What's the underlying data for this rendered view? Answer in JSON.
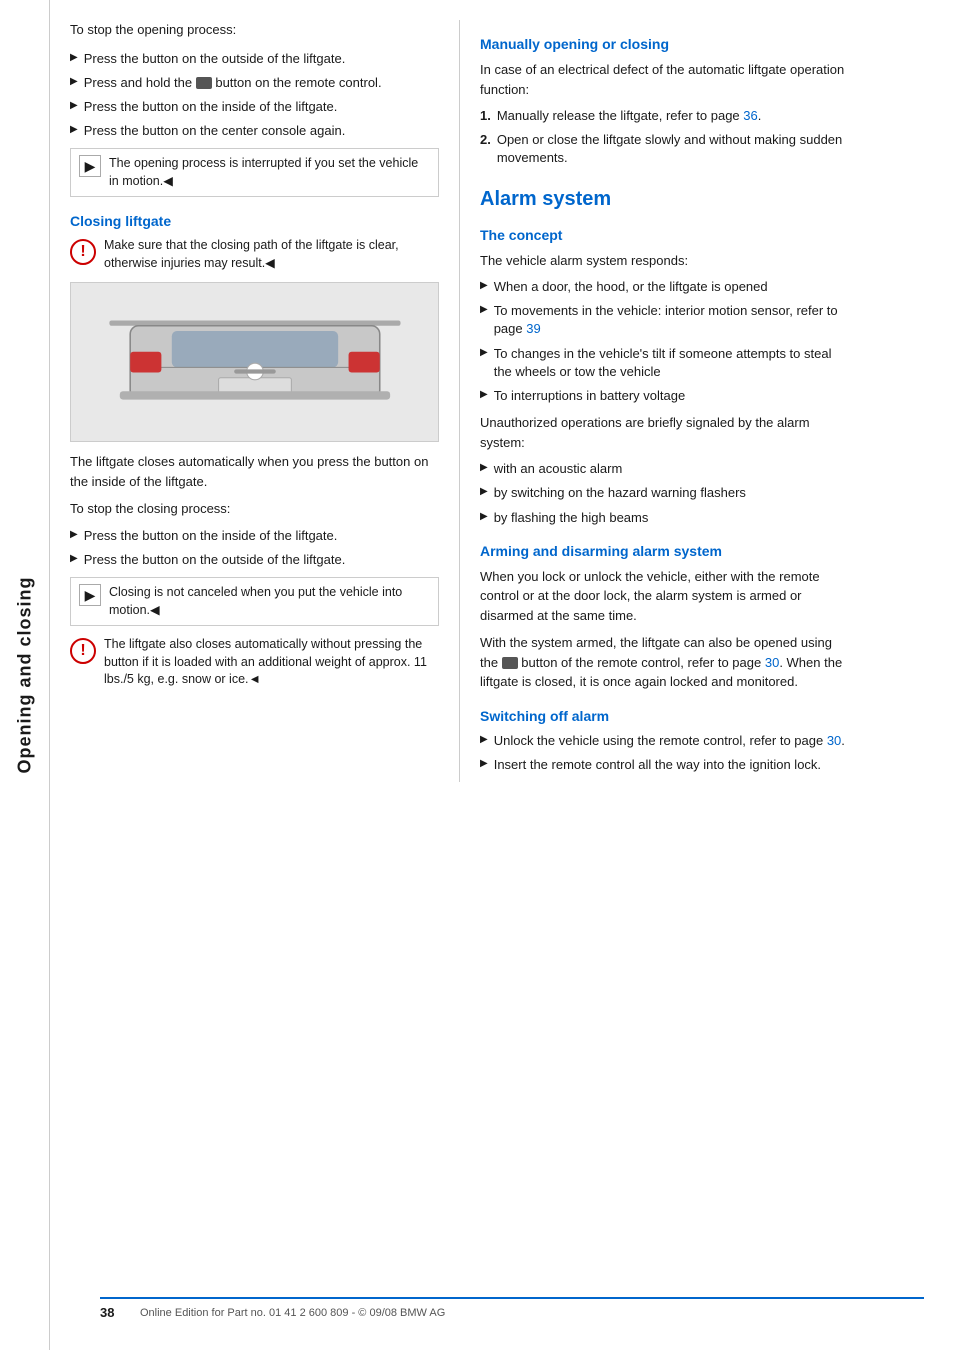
{
  "sidebar": {
    "label": "Opening and closing"
  },
  "left": {
    "intro": "To stop the opening process:",
    "stop_opening_bullets": [
      "Press the button on the outside of the liftgate.",
      "Press and hold the [remote] button on the remote control.",
      "Press the button on the inside of the liftgate.",
      "Press the button on the center console again."
    ],
    "note_opening": "The opening process is interrupted if you set the vehicle in motion.◄",
    "closing_heading": "Closing liftgate",
    "warning_closing": "Make sure that the closing path of the liftgate is clear, otherwise injuries may result.◄",
    "liftgate_auto_close": "The liftgate closes automatically when you press the button on the inside of the liftgate.",
    "stop_closing_intro": "To stop the closing process:",
    "stop_closing_bullets": [
      "Press the button on the inside of the liftgate.",
      "Press the button on the outside of the liftgate."
    ],
    "note_closing": "Closing is not canceled when you put the vehicle into motion.◄",
    "warning_auto": "The liftgate also closes automatically without pressing the button if it is loaded with an additional weight of approx. 11 lbs./5 kg, e.g. snow or ice.◄"
  },
  "right": {
    "manually_heading": "Manually opening or closing",
    "manually_intro": "In case of an electrical defect of the automatic liftgate operation function:",
    "manually_steps": [
      "Manually release the liftgate, refer to page 36.",
      "Open or close the liftgate slowly and without making sudden movements."
    ],
    "alarm_heading": "Alarm system",
    "concept_heading": "The concept",
    "concept_intro": "The vehicle alarm system responds:",
    "concept_bullets": [
      "When a door, the hood, or the liftgate is opened",
      "To movements in the vehicle: interior motion sensor, refer to page 39",
      "To changes in the vehicle's tilt if someone attempts to steal the wheels or tow the vehicle",
      "To interruptions in battery voltage"
    ],
    "unauthorized_text": "Unauthorized operations are briefly signaled by the alarm system:",
    "alarm_signals": [
      "with an acoustic alarm",
      "by switching on the hazard warning flashers",
      "by flashing the high beams"
    ],
    "arming_heading": "Arming and disarming alarm system",
    "arming_text1": "When you lock or unlock the vehicle, either with the remote control or at the door lock, the alarm system is armed or disarmed at the same time.",
    "arming_text2": "With the system armed, the liftgate can also be opened using the [remote] button of the remote control, refer to page 30. When the liftgate is closed, it is once again locked and monitored.",
    "switching_heading": "Switching off alarm",
    "switching_bullets": [
      "Unlock the vehicle using the remote control, refer to page 30.",
      "Insert the remote control all the way into the ignition lock."
    ]
  },
  "footer": {
    "page_num": "38",
    "edition_text": "Online Edition for Part no. 01 41 2 600 809 - © 09/08 BMW AG"
  },
  "links": {
    "page36": "36",
    "page39": "39",
    "page30": "30",
    "page30b": "30"
  }
}
